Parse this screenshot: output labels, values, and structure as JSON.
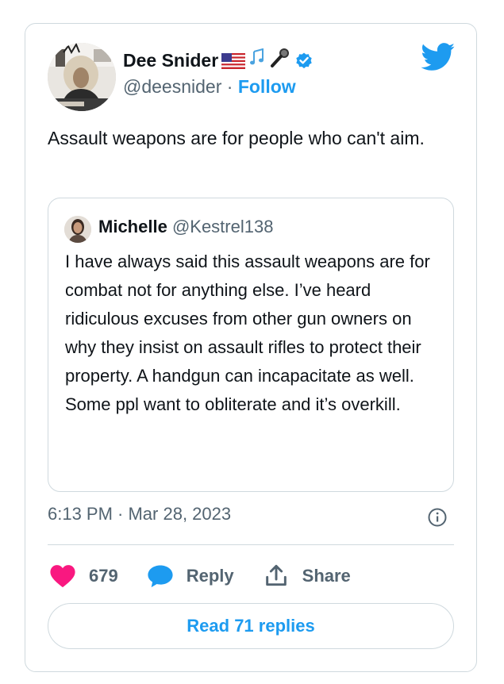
{
  "author": {
    "name": "Dee Snider",
    "handle": "@deesnider",
    "separator": " · ",
    "follow_label": "Follow",
    "avatar_icon": "avatar-photo",
    "name_emoji": [
      "us-flag-icon",
      "music-notes-icon",
      "microphone-icon"
    ],
    "verified_icon": "verified-badge-icon"
  },
  "brand_icon": "twitter-bird-icon",
  "tweet_text": "Assault weapons are for people who can't aim.",
  "quoted_tweet": {
    "name": "Michelle",
    "handle": "@Kestrel138",
    "text": "I have always said this assault weapons are for combat not for anything else. I’ve heard ridiculous excuses from other gun owners on why they insist on assault rifles to protect their property. A handgun can incapacitate as well. Some ppl want to obliterate and it’s overkill."
  },
  "timestamp": "6:13 PM · Mar 28, 2023",
  "actions": {
    "like_count": "679",
    "reply_label": "Reply",
    "share_label": "Share"
  },
  "read_replies_label": "Read 71 replies",
  "colors": {
    "accent": "#1d9bf0",
    "like": "#f91880",
    "text": "#0f1419",
    "secondary": "#536471",
    "border": "#cfd9de"
  }
}
